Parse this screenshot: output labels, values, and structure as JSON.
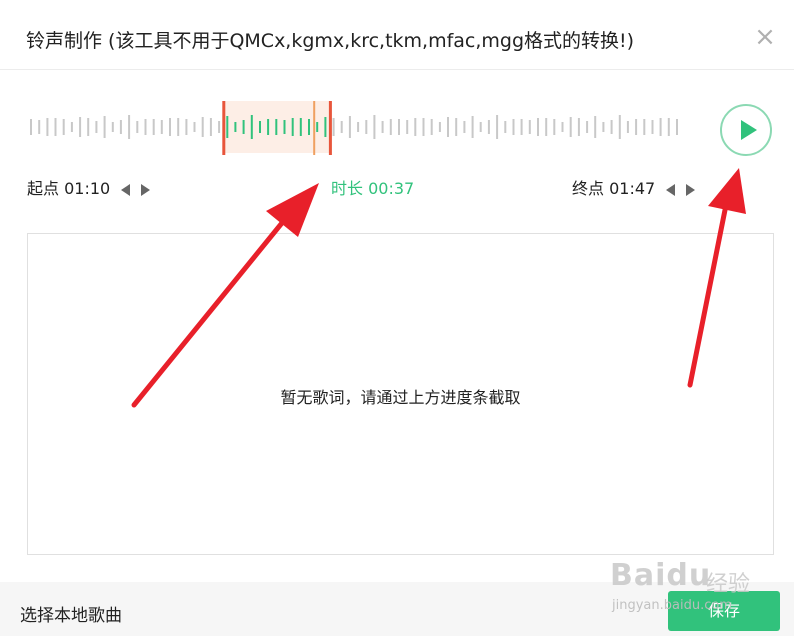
{
  "dialog": {
    "title": "铃声制作 (该工具不用于QMCx,kgmx,krc,tkm,mfac,mgg格式的转换!)",
    "close_icon": "close-icon"
  },
  "waveform": {
    "bar_count": 80,
    "selection_start_fraction": 0.3,
    "selection_end_fraction": 0.465,
    "playhead_fraction": 0.44,
    "colors": {
      "bar": "#c8c8c8",
      "selected_bar": "#31c27c",
      "selection_bg": "#fdeee6",
      "handle": "#e8553b",
      "playhead": "#f0a060"
    }
  },
  "play_button": {
    "icon": "play-icon",
    "color": "#31c27c"
  },
  "times": {
    "start_label": "起点",
    "start_value": "01:10",
    "duration_label": "时长",
    "duration_value": "00:37",
    "end_label": "终点",
    "end_value": "01:47"
  },
  "lyrics": {
    "empty_text": "暂无歌词，请通过上方进度条截取"
  },
  "footer": {
    "local_song_label": "选择本地歌曲",
    "save_label": "保存"
  },
  "watermark": {
    "brand": "Baidu",
    "brand_cn": "经验",
    "url": "jingyan.baidu.com"
  },
  "annotation": {
    "arrow_color": "#e8202a"
  },
  "colors": {
    "accent": "#31c27c"
  }
}
